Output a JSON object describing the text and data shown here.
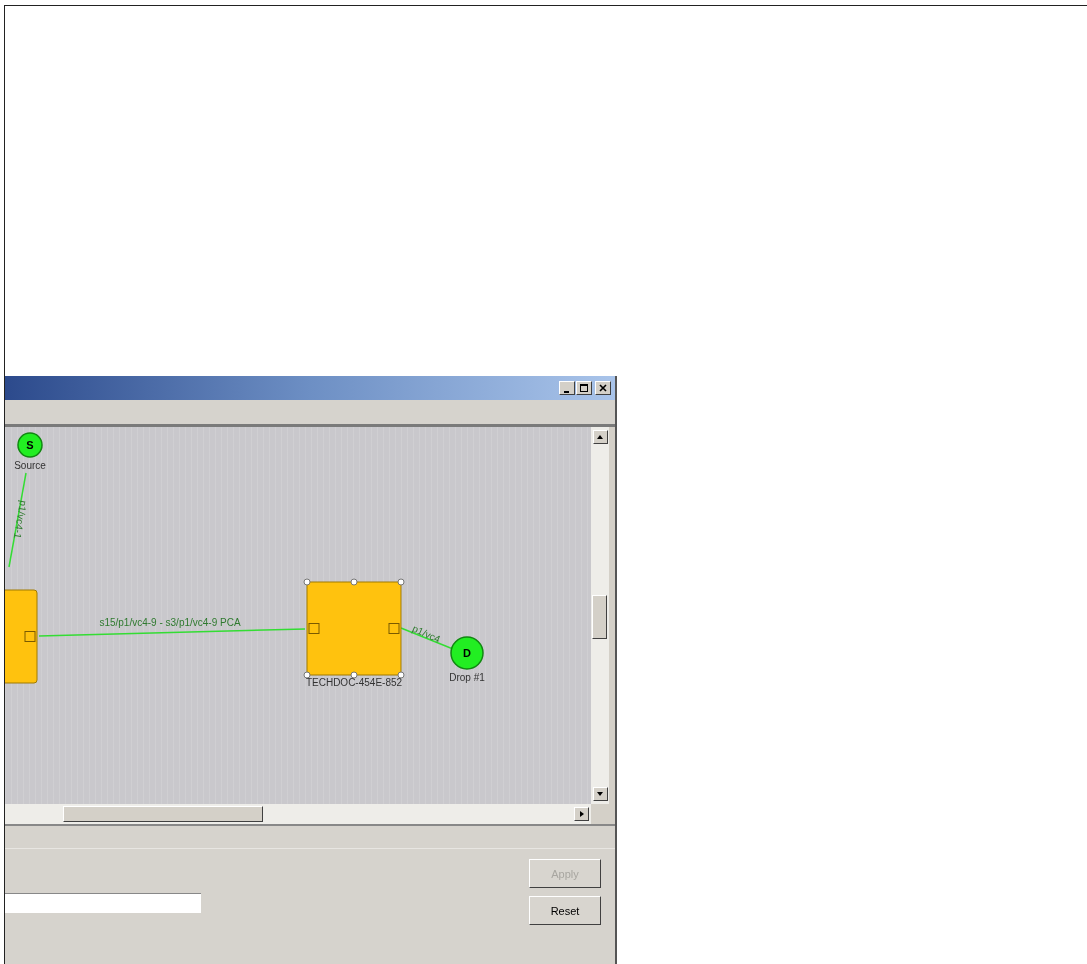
{
  "diagram": {
    "nodes": [
      {
        "kind": "endpoint",
        "letter": "S",
        "label": "Source",
        "selected": false
      },
      {
        "kind": "device",
        "selected": false
      },
      {
        "kind": "device",
        "label": "TECHDOC-454E-852",
        "selected": true
      },
      {
        "kind": "endpoint",
        "letter": "D",
        "label": "Drop #1",
        "selected": false
      }
    ],
    "links": [
      {
        "label": "p1/vc4-1"
      },
      {
        "label": "s15/p1/vc4-9 - s3/p1/vc4-9 PCA"
      },
      {
        "label": "p1/vc4"
      }
    ]
  },
  "buttons": [
    {
      "label": "Apply",
      "disabled": true
    },
    {
      "label": "Reset",
      "disabled": false
    }
  ]
}
